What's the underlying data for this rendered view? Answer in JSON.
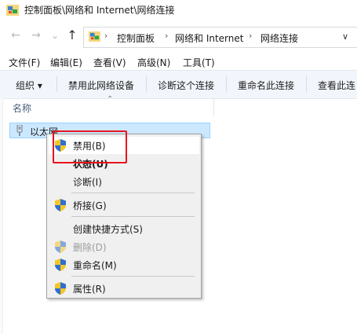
{
  "window": {
    "title": "控制面板\\网络和 Internet\\网络连接"
  },
  "nav": {
    "back_icon": "←",
    "forward_icon": "→",
    "history_icon": "⌄",
    "up_icon": "↑",
    "breadcrumbs": [
      "控制面板",
      "网络和 Internet",
      "网络连接"
    ],
    "sep_icon": "›",
    "dropdown_icon": "∨"
  },
  "menubar": [
    "文件(F)",
    "编辑(E)",
    "查看(V)",
    "高级(N)",
    "工具(T)"
  ],
  "commandbar": {
    "organize": "组织 ▾",
    "items": [
      "禁用此网络设备",
      "诊断这个连接",
      "重命名此连接",
      "查看此连"
    ]
  },
  "list": {
    "column_name": "名称",
    "sort_icon": "⌃",
    "items": [
      {
        "name": "以太网"
      }
    ]
  },
  "context_menu": {
    "items": [
      {
        "label": "禁用(B)",
        "shield": true
      },
      {
        "label": "状态(U)",
        "shield": false,
        "bold": true
      },
      {
        "label": "诊断(I)",
        "shield": false
      },
      {
        "label": "桥接(G)",
        "shield": true
      },
      {
        "label": "创建快捷方式(S)",
        "shield": false
      },
      {
        "label": "删除(D)",
        "shield": true,
        "disabled": true
      },
      {
        "label": "重命名(M)",
        "shield": true
      },
      {
        "label": "属性(R)",
        "shield": true
      }
    ]
  },
  "colors": {
    "selection": "#cce8ff",
    "highlight_box": "#e8141c",
    "commandbar_bg": "#f2f6fc"
  }
}
